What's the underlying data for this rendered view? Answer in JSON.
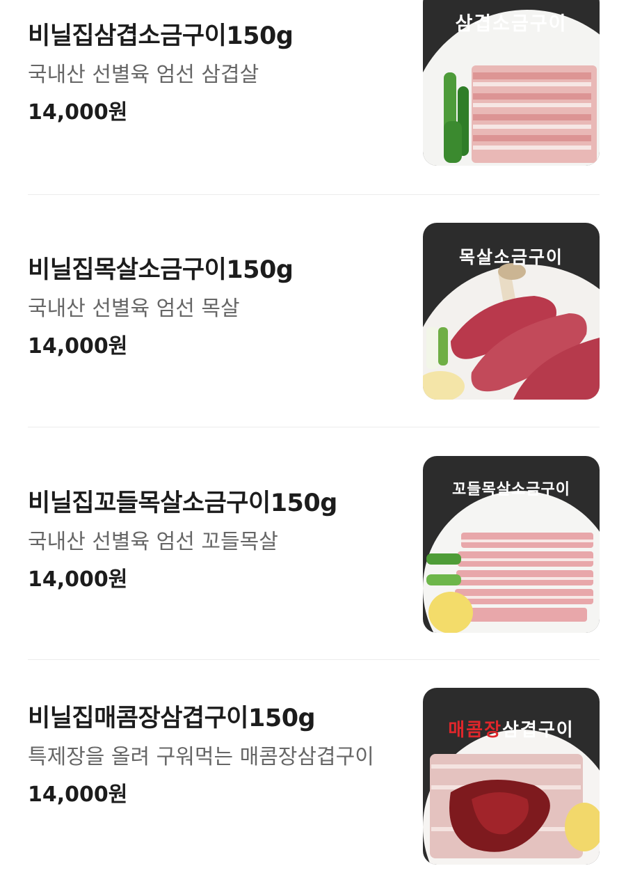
{
  "menu": {
    "items": [
      {
        "name": "비닐집삼겹소금구이150g",
        "description": "국내산 선별육 엄선 삼겹살",
        "price": "14,000원",
        "image_caption": "삼겹소금구이",
        "image_caption_accent": ""
      },
      {
        "name": "비닐집목살소금구이150g",
        "description": "국내산 선별육 엄선 목살",
        "price": "14,000원",
        "image_caption": "목살소금구이",
        "image_caption_accent": ""
      },
      {
        "name": "비닐집꼬들목살소금구이150g",
        "description": "국내산 선별육 엄선 꼬들목살",
        "price": "14,000원",
        "image_caption": "꼬들목살소금구이",
        "image_caption_accent": ""
      },
      {
        "name": "비닐집매콤장삼겹구이150g",
        "description": "특제장을 올려 구워먹는 매콤장삼겹구이",
        "price": "14,000원",
        "image_caption": "삼겹구이",
        "image_caption_accent": "매콤장"
      }
    ]
  },
  "colors": {
    "text_primary": "#1c1c1c",
    "text_secondary": "#666666",
    "divider": "#ececec",
    "thumb_background": "#2c2c2c",
    "caption_accent": "#e0262b"
  }
}
